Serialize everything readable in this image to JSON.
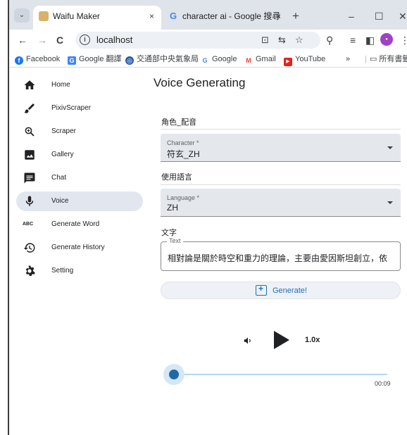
{
  "browser": {
    "tabs": [
      {
        "title": "Waifu Maker",
        "close": "×"
      },
      {
        "title": "character ai - Google 搜尋",
        "close": "×"
      }
    ],
    "new_tab": "+",
    "window_controls": {
      "minimize": "–",
      "maximize": "☐",
      "close": "✕"
    },
    "toolbar": {
      "back": "←",
      "forward": "→",
      "reload": "C",
      "url": "localhost",
      "menu": "⋮"
    },
    "bookmarks": [
      {
        "label": "Facebook",
        "icon": "facebook-icon",
        "color": "#1877f2",
        "glyph": "f"
      },
      {
        "label": "Google 翻譯",
        "icon": "translate-icon",
        "color": "#4285f4",
        "glyph": "G"
      },
      {
        "label": "交通部中央氣象局",
        "icon": "weather-icon",
        "color": "#2a5caa",
        "glyph": "◎"
      },
      {
        "label": "Google",
        "icon": "google-icon",
        "color": "#ffffff",
        "glyph": "G"
      },
      {
        "label": "Gmail",
        "icon": "gmail-icon",
        "color": "#ffffff",
        "glyph": "M"
      },
      {
        "label": "YouTube",
        "icon": "youtube-icon",
        "color": "#e62117",
        "glyph": "▶"
      }
    ],
    "bookmarks_more": "»",
    "bookmarks_all": "所有書籤"
  },
  "sidebar": {
    "items": [
      {
        "label": "Home",
        "icon": "home-icon"
      },
      {
        "label": "PixivScraper",
        "icon": "brush-icon"
      },
      {
        "label": "Scraper",
        "icon": "magnifier-icon"
      },
      {
        "label": "Gallery",
        "icon": "image-icon"
      },
      {
        "label": "Chat",
        "icon": "chat-icon"
      },
      {
        "label": "Voice",
        "icon": "microphone-icon",
        "active": true
      },
      {
        "label": "Generate Word",
        "icon": "abc-icon",
        "glyph": "ABC"
      },
      {
        "label": "Generate History",
        "icon": "history-icon"
      },
      {
        "label": "Setting",
        "icon": "gear-icon"
      }
    ]
  },
  "main": {
    "title": "Voice Generating",
    "character_section": "角色_配音",
    "character_select": {
      "label": "Character *",
      "value": "符玄_ZH"
    },
    "language_section": "使用語言",
    "language_select": {
      "label": "Language *",
      "value": "ZH"
    },
    "text_section": "文字",
    "text_field": {
      "label": "Text",
      "value": "相對論是關於時空和重力的理論，主要由愛因斯坦創立，依"
    },
    "generate_button": "Generate!"
  },
  "player": {
    "speed": "1.0x",
    "time": "00:09",
    "progress": 0.03
  }
}
